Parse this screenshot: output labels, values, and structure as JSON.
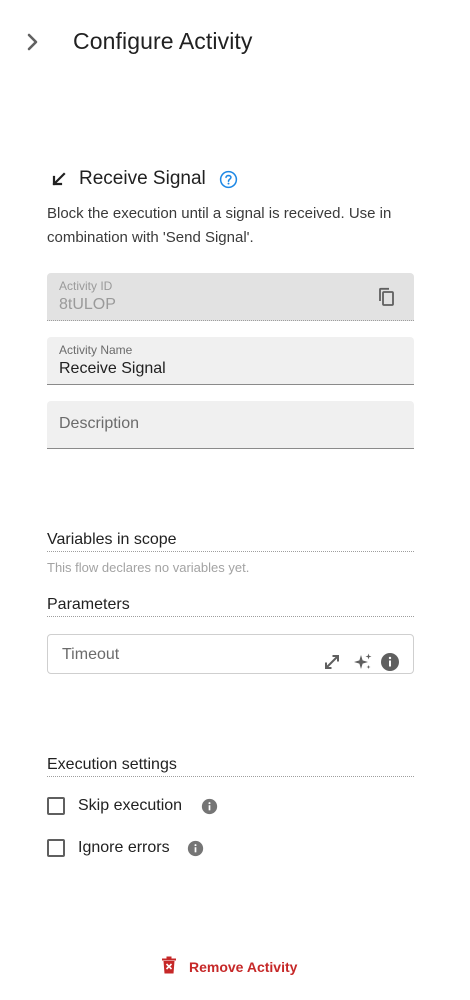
{
  "header": {
    "title": "Configure Activity",
    "collapse_icon": "chevron-right-icon"
  },
  "activity": {
    "icon": "arrow-down-left-icon",
    "title": "Receive Signal",
    "help_icon": "help-circle-icon",
    "description": "Block the execution until a signal is received. Use in combination with 'Send Signal'."
  },
  "fields": {
    "activity_id": {
      "label": "Activity ID",
      "value": "8tULOP",
      "disabled": true,
      "copy_icon": "copy-icon"
    },
    "activity_name": {
      "label": "Activity Name",
      "value": "Receive Signal"
    },
    "description": {
      "placeholder": "Description"
    }
  },
  "variables": {
    "title": "Variables in scope",
    "empty_text": "This flow declares no variables yet."
  },
  "parameters": {
    "title": "Parameters",
    "timeout": {
      "placeholder": "Timeout",
      "icons": [
        "expand-icon",
        "sparkle-icon",
        "info-icon"
      ]
    }
  },
  "execution": {
    "title": "Execution settings",
    "skip_execution": {
      "label": "Skip execution",
      "checked": false
    },
    "ignore_errors": {
      "label": "Ignore errors",
      "checked": false
    }
  },
  "footer": {
    "remove_label": "Remove Activity",
    "remove_icon": "trash-icon"
  },
  "colors": {
    "accent_blue": "#1976d2",
    "danger_red": "#c62828",
    "field_bg": "#f0f0f0",
    "field_disabled_bg": "#e2e2e2"
  }
}
